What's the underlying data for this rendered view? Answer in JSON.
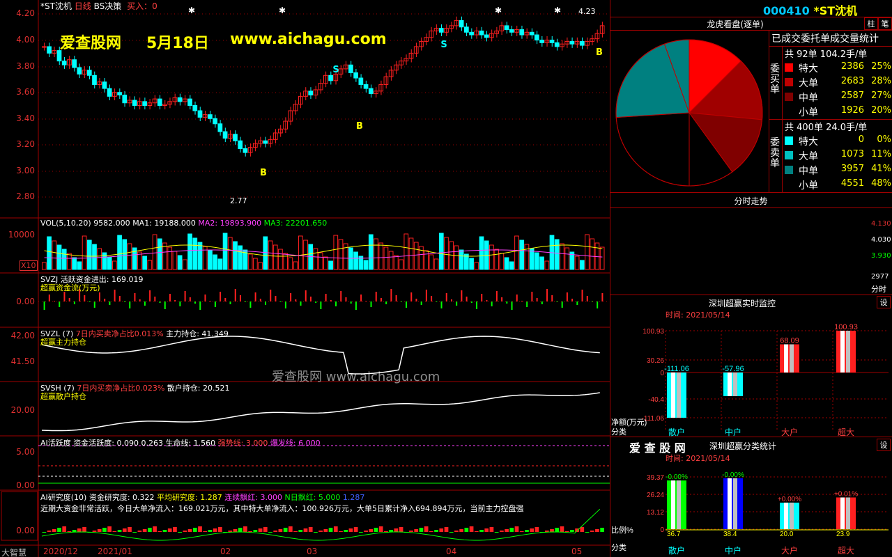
{
  "colors": {
    "up": "#ff2020",
    "down": "#00ffff",
    "grid": "#a00000",
    "accent": "#ffff00",
    "magenta": "#ff40ff",
    "green": "#00ff00"
  },
  "main": {
    "title": "*ST沈机",
    "period": "日线",
    "indicator": "BS决策",
    "signal": "买入：0",
    "y_ticks": [
      "4.20",
      "4.00",
      "3.80",
      "3.60",
      "3.40",
      "3.20",
      "3.00",
      "2.80"
    ],
    "high_marker": "4.23",
    "low_marker": "2.77",
    "bs_labels": {
      "s": "S",
      "b": "B"
    },
    "watermark": {
      "site": "爱查股网",
      "date": "5月18日",
      "url": "www.aichagu.com"
    }
  },
  "vol": {
    "label": "VOL(5,10,20)",
    "value": "9582.000",
    "ma1": "MA1: 19188.000",
    "ma2": "MA2: 19893.900",
    "ma3": "MA3: 22201.650",
    "y_tick": "10000",
    "unit": "X10"
  },
  "svzj": {
    "name": "SVZJ",
    "label": "活跃资金进出: 169.019",
    "sub": "超赢资金流(万元)",
    "y_tick": "0.00"
  },
  "svzl": {
    "name": "SVZL (7)",
    "ratio": "7日内买卖净占比0.013%",
    "hold": "主力持仓: 41.349",
    "sub": "超赢主力持仓",
    "y_ticks": [
      "42.00",
      "41.50"
    ]
  },
  "svsh": {
    "name": "SVSH (7)",
    "ratio": "7日内买卖净占比0.023%",
    "hold": "散户持仓: 20.521",
    "sub": "超赢散户持仓",
    "y_tick": "20.00"
  },
  "ai1": {
    "name": "AI活跃度",
    "active": "资金活跃度: 0.090",
    "v2": "0.263",
    "life": "生命线: 1.560",
    "strong": "强势线: 3.000",
    "burst": "爆发线: 6.000",
    "y_ticks": [
      "5.00",
      "0.00"
    ]
  },
  "ai2": {
    "name": "AI研究度(10)",
    "research": "资金研究度: 0.322",
    "avg": "平均研究度: 1.287",
    "cont": "连续飘红: 3.000",
    "nday": "N日飘红: 5.000",
    "v5": "1.287",
    "summary": "近期大资金非常活跃，今日大单净流入：169.021万元，其中特大单净流入：100.926万元，大单5日累计净入694.894万元，当前主力控盘强",
    "y_tick": "0.00"
  },
  "xaxis": {
    "corner": "大智慧",
    "labels": [
      "2020/12",
      "2021/01",
      "02",
      "03",
      "04",
      "05"
    ]
  },
  "right": {
    "code": "000410",
    "name": "*ST沈机",
    "tabs": [
      "柱",
      "笔"
    ],
    "dragon_title": "龙虎看盘(逐单)",
    "stats_title": "已成交委托单成交量统计",
    "buy": {
      "side": "委买单",
      "total": "共 92单 104.2手/单",
      "rows": [
        {
          "label": "特大",
          "val": "2386",
          "pct": "25%",
          "color": "#ff0000"
        },
        {
          "label": "大单",
          "val": "2683",
          "pct": "28%",
          "color": "#c00000"
        },
        {
          "label": "中单",
          "val": "2587",
          "pct": "27%",
          "color": "#800000"
        },
        {
          "label": "小单",
          "val": "1926",
          "pct": "20%",
          "color": "#000000"
        }
      ]
    },
    "sell": {
      "side": "委卖单",
      "total": "共 400单 24.0手/单",
      "rows": [
        {
          "label": "特大",
          "val": "0",
          "pct": "0%",
          "color": "#00ffff"
        },
        {
          "label": "大单",
          "val": "1073",
          "pct": "11%",
          "color": "#00c0c0"
        },
        {
          "label": "中单",
          "val": "3957",
          "pct": "41%",
          "color": "#008080"
        },
        {
          "label": "小单",
          "val": "4551",
          "pct": "48%",
          "color": "#000000"
        }
      ]
    },
    "intraday": {
      "title": "分时走势",
      "ticks": [
        "4.130",
        "4.030",
        "3.930",
        "2977",
        "分时"
      ]
    },
    "monitor": {
      "title": "深圳超赢实时监控",
      "btn": "设",
      "time": "时间: 2021/05/14",
      "y_ticks": [
        "100.93",
        "30.26",
        "0",
        "-40.4",
        "-111.06"
      ],
      "ylabel": "净额(万元)",
      "xlabel": "分类",
      "categories": [
        "散户",
        "中户",
        "大户",
        "超大"
      ],
      "values": [
        -111.06,
        -57.96,
        68.09,
        100.93
      ],
      "value_labels": [
        "-111.06",
        "-57.96",
        "68.09",
        "100.93"
      ],
      "colors": [
        "#00ffff",
        "#00ffff",
        "#ff2020",
        "#ff2020"
      ]
    },
    "classify": {
      "brand": "爱 查 股 网",
      "title": "深圳超赢分类统计",
      "btn": "设",
      "time": "时间: 2021/05/14",
      "y_ticks": [
        "39.37",
        "26.24",
        "13.12",
        "0"
      ],
      "ylabel": "比例%",
      "xlabel": "分类",
      "categories": [
        "散户",
        "中户",
        "大户",
        "超大"
      ],
      "values": [
        36.7,
        38.4,
        20.0,
        23.9
      ],
      "top_labels": [
        "-0.00%",
        "-0.00%",
        "+0.00%",
        "+0.01%"
      ],
      "bottom_labels": [
        "36.7",
        "38.4",
        "20.0",
        "23.9"
      ],
      "colors": [
        "#00ff00",
        "#0000ff",
        "#00ffff",
        "#ff2020"
      ]
    }
  },
  "overlay_watermark": "爱查股网    www.aichagu.com"
}
